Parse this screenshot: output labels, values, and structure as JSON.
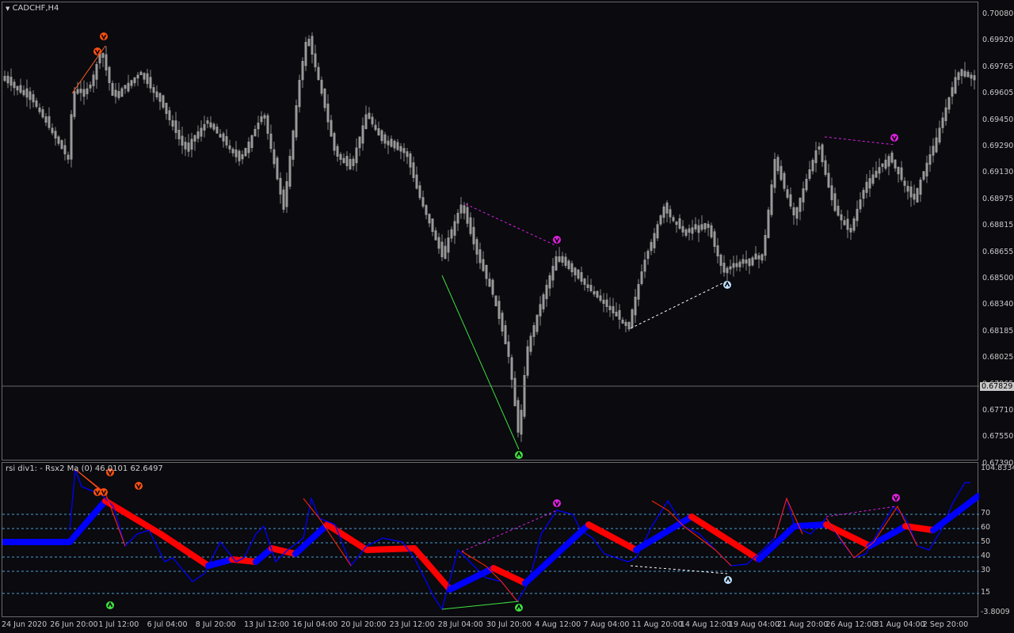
{
  "chart": {
    "symbol_title": "CADCHF,H4",
    "current_price": "0.67829",
    "colors": {
      "background": "#0a0a0f",
      "candles": "#9a9a9a",
      "bull": "#0000ff",
      "bear": "#ff0000",
      "grid": "#4aa0d0",
      "bear_div": "#e020e0",
      "bull_div": "#c0e0ff"
    }
  },
  "price_axis": {
    "labels": [
      "0.70080",
      "0.69920",
      "0.69765",
      "0.69605",
      "0.69450",
      "0.69290",
      "0.69130",
      "0.68975",
      "0.68815",
      "0.68655",
      "0.68500",
      "0.68340",
      "0.68185",
      "0.68025",
      "0.67865",
      "0.67710",
      "0.67550",
      "0.67390"
    ]
  },
  "indicator": {
    "title": "rsi div1: - Rsx2 Ma (0) 46.0101 62.6497",
    "max_label": "104.8334",
    "min_label": "-3.8009",
    "levels": [
      "70",
      "60",
      "50",
      "40",
      "30",
      "15"
    ]
  },
  "time_axis": {
    "labels": [
      "24 Jun 2020",
      "26 Jun 20:00",
      "1 Jul 12:00",
      "6 Jul 04:00",
      "8 Jul 20:00",
      "13 Jul 12:00",
      "16 Jul 04:00",
      "20 Jul 20:00",
      "23 Jul 12:00",
      "28 Jul 04:00",
      "30 Jul 20:00",
      "4 Aug 12:00",
      "7 Aug 04:00",
      "11 Aug 20:00",
      "14 Aug 12:00",
      "19 Aug 04:00",
      "21 Aug 20:00",
      "26 Aug 12:00",
      "31 Aug 04:00",
      "2 Sep 20:00"
    ]
  },
  "icons": [
    "arrow-up-icon",
    "arrow-down-icon"
  ]
}
